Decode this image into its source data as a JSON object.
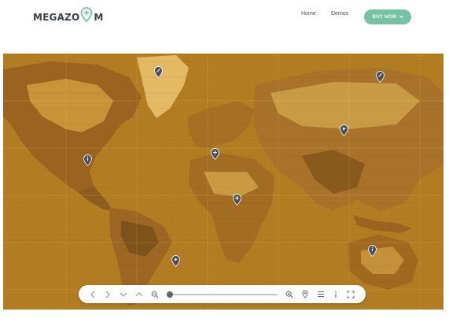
{
  "header": {
    "logo_left": "MEGAZO",
    "logo_right": "M",
    "nav": [
      {
        "label": "Home"
      },
      {
        "label": "Demos"
      }
    ],
    "buy_button": {
      "label": "BUY NOW",
      "icon": "chevron-down-icon"
    }
  },
  "colors": {
    "accent": "#75c3a5",
    "map_base": "#b9821f",
    "map_dark": "#8a5a1c",
    "map_light": "#d9a94a",
    "pin": "#4b4f59"
  },
  "map": {
    "markers": [
      {
        "name": "marker-greenland",
        "icon": "leaf-icon"
      },
      {
        "name": "marker-siberia-east",
        "icon": "leaf-icon"
      },
      {
        "name": "marker-russia",
        "icon": "play-icon"
      },
      {
        "name": "marker-europe",
        "icon": "plus-icon"
      },
      {
        "name": "marker-north-america",
        "icon": "info-icon"
      },
      {
        "name": "marker-africa",
        "icon": "plus-icon"
      },
      {
        "name": "marker-south-america",
        "icon": "play-icon"
      },
      {
        "name": "marker-australia",
        "icon": "info-icon"
      }
    ]
  },
  "toolbar": {
    "buttons": [
      "chevron-left-icon",
      "chevron-right-icon",
      "chevron-down-icon",
      "chevron-up-icon",
      "zoom-out-icon",
      "zoom-in-icon",
      "location-pin-icon",
      "menu-icon",
      "info-icon",
      "fullscreen-icon"
    ],
    "zoom_level": 0.0
  }
}
